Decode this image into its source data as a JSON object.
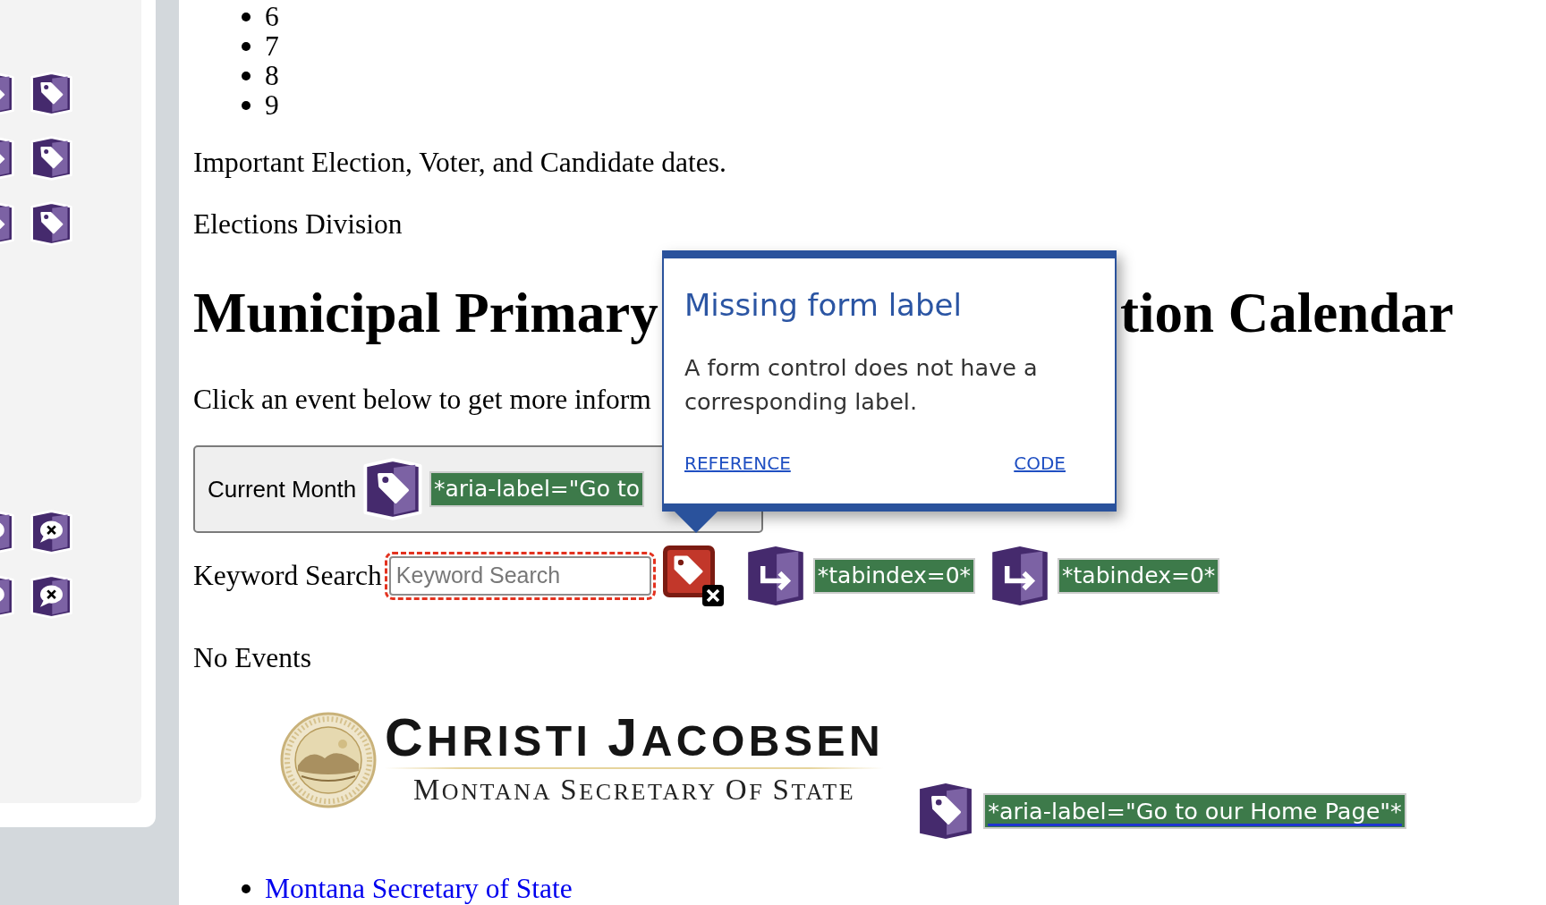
{
  "list": {
    "items": [
      "6",
      "7",
      "8",
      "9"
    ]
  },
  "intro": "Important Election, Voter, and Candidate dates.",
  "division": "Elections Division",
  "heading": {
    "parts": [
      "Municipal Primary",
      "tion Calendar"
    ]
  },
  "instruction": "Click an event below to get more inform",
  "current_month": {
    "label": "Current Month",
    "annotation": "*aria-label=\"Go to"
  },
  "keyword_search": {
    "label": "Keyword Search",
    "placeholder": "Keyword Search",
    "flagged": true,
    "annotations": [
      "*tabindex=0*",
      "*tabindex=0*"
    ]
  },
  "events": {
    "message": "No Events"
  },
  "logo": {
    "name": "CHRISTI JACOBSEN",
    "subtitle": "MONTANA SECRETARY OF STATE",
    "annotation": "*aria-label=\"Go to our Home Page\"*"
  },
  "links": [
    "Montana Secretary of State"
  ],
  "popup": {
    "title": "Missing form label",
    "description": "A form control does not have a corresponding label.",
    "links": [
      "REFERENCE",
      "CODE"
    ]
  }
}
